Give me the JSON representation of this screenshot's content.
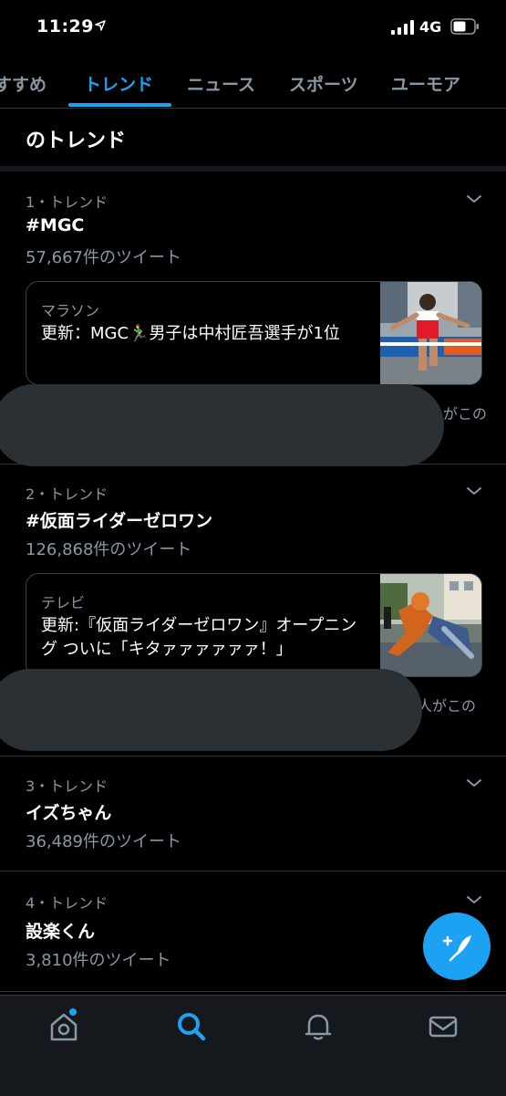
{
  "status": {
    "time": "11:29",
    "network": "4G"
  },
  "tabs": [
    {
      "label": "すすめ",
      "active": false
    },
    {
      "label": "トレンド",
      "active": true
    },
    {
      "label": "ニュース",
      "active": false
    },
    {
      "label": "スポーツ",
      "active": false
    },
    {
      "label": "ユーモア",
      "active": false
    }
  ],
  "section": {
    "title": "のトレンド"
  },
  "trends": [
    {
      "rank": "1・トレンド",
      "name": "#MGC",
      "count": "57,667件のツイート",
      "card": {
        "category": "マラソン",
        "text": "更新：MGC🏃‍♂️男子は中村匠吾選手が1位"
      },
      "peek": "がこの"
    },
    {
      "rank": "2・トレンド",
      "name": "#仮面ライダーゼロワン",
      "count": "126,868件のツイート",
      "card": {
        "category": "テレビ",
        "text": "更新:『仮面ライダーゼロワン』オープニング ついに「キタァァァァァァ！」"
      },
      "peek": "人がこの"
    },
    {
      "rank": "3・トレンド",
      "name": "イズちゃん",
      "count": "36,489件のツイート"
    },
    {
      "rank": "4・トレンド",
      "name": "設楽くん",
      "count": "3,810件のツイート"
    }
  ],
  "colors": {
    "accent": "#1da1f2",
    "muted": "#8899a6",
    "divider": "#2f3336",
    "background": "#000000"
  },
  "icons": {
    "status": [
      "location-arrow-icon",
      "signal-bars-icon",
      "battery-icon"
    ],
    "nav": [
      "home-icon",
      "search-icon",
      "bell-icon",
      "mail-icon"
    ],
    "fab": "compose-tweet-icon",
    "trend": "chevron-down-icon"
  }
}
